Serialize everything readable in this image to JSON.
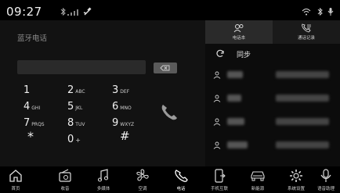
{
  "status_bar": {
    "time": "09:27",
    "icons": [
      "bluetooth-icon",
      "signal-icon",
      "usb-icon",
      "wifi-icon",
      "bluetooth-icon",
      "microphone-icon"
    ]
  },
  "dialer": {
    "title": "蓝牙电话",
    "number_value": "",
    "keys": [
      {
        "digit": "1",
        "letters": ""
      },
      {
        "digit": "2",
        "letters": "ABC"
      },
      {
        "digit": "3",
        "letters": "DEF"
      },
      {
        "digit": "4",
        "letters": "GHI"
      },
      {
        "digit": "5",
        "letters": "JKL"
      },
      {
        "digit": "6",
        "letters": "MNO"
      },
      {
        "digit": "7",
        "letters": "PRQS"
      },
      {
        "digit": "8",
        "letters": "TUV"
      },
      {
        "digit": "9",
        "letters": "WXYZ"
      },
      {
        "digit": "*",
        "letters": ""
      },
      {
        "digit": "0",
        "letters": "+"
      },
      {
        "digit": "#",
        "letters": ""
      }
    ]
  },
  "contacts_panel": {
    "tabs": [
      {
        "label": "电话本",
        "icon": "contacts-icon"
      },
      {
        "label": "通话记录",
        "icon": "call-log-icon"
      }
    ],
    "sync_label": "同步"
  },
  "bottom_nav": {
    "items": [
      {
        "label": "首页",
        "icon": "home-icon"
      },
      {
        "label": "收音",
        "icon": "radio-icon"
      },
      {
        "label": "多媒体",
        "icon": "music-icon"
      },
      {
        "label": "空调",
        "icon": "fan-icon"
      },
      {
        "label": "电话",
        "icon": "phone-icon"
      },
      {
        "label": "手机互联",
        "icon": "phone-link-icon"
      },
      {
        "label": "新能源",
        "icon": "car-icon"
      },
      {
        "label": "系统设置",
        "icon": "settings-icon"
      },
      {
        "label": "语音助理",
        "icon": "microphone-icon"
      }
    ],
    "selected": "电话"
  },
  "colors": {
    "background": "#000000",
    "panel_left": "#121212",
    "panel_right": "#0c0c0c",
    "text": "#e6e6e6"
  }
}
